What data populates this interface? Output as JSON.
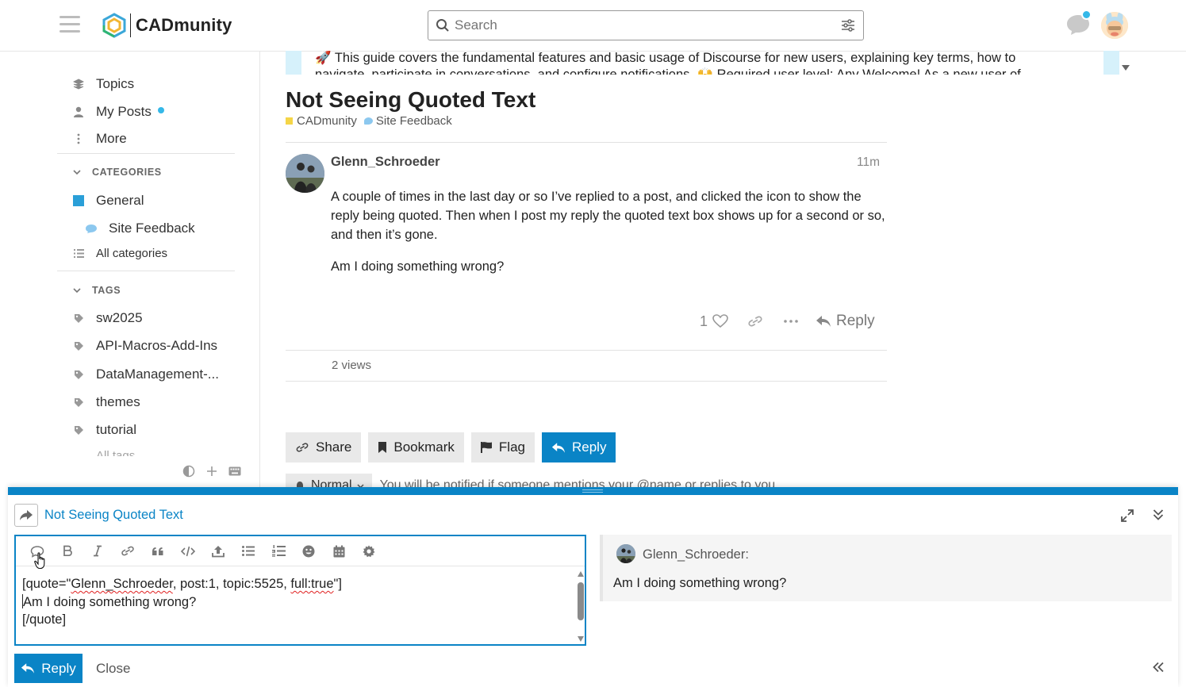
{
  "header": {
    "logo_text": "CADmunity",
    "search_placeholder": "Search"
  },
  "sidebar": {
    "nav": [
      {
        "label": "Topics",
        "icon": "layers-icon"
      },
      {
        "label": "My Posts",
        "icon": "user-icon"
      },
      {
        "label": "More",
        "icon": "vertical-ellipsis-icon"
      }
    ],
    "categories_heading": "CATEGORIES",
    "categories": [
      {
        "label": "General",
        "color": "#2a9fd8"
      },
      {
        "label": "Site Feedback",
        "color": "#8cc8ef"
      }
    ],
    "all_categories": "All categories",
    "tags_heading": "TAGS",
    "tags": [
      "sw2025",
      "API-Macros-Add-Ins",
      "DataManagement-...",
      "themes",
      "tutorial"
    ],
    "tags_partial": "All tags"
  },
  "banner": {
    "text": "🚀 This guide covers the fundamental features and basic usage of Discourse for new users, explaining key terms, how to navigate, participate in conversations, and configure notifications. 🙌 Required user level: Any Welcome! As a new user of"
  },
  "topic": {
    "title": "Not Seeing Quoted Text",
    "category_parent": "CADmunity",
    "category_parent_color": "#f5d547",
    "category": "Site Feedback",
    "category_color": "#8cc8ef"
  },
  "post": {
    "author": "Glenn_Schroeder",
    "time": "11m",
    "paragraphs": [
      "A couple of times in the last day or so I’ve replied to a post, and clicked the icon to show the reply being quoted. Then when I post my reply the quoted text box shows up for a second or so, and then it’s gone.",
      "Am I doing something wrong?"
    ],
    "like_count": "1",
    "reply_label": "Reply",
    "views": "2 views"
  },
  "footer_buttons": {
    "share": "Share",
    "bookmark": "Bookmark",
    "flag": "Flag",
    "reply": "Reply"
  },
  "notifications": {
    "level": "Normal",
    "text": "You will be notified if someone mentions your @name or replies to you."
  },
  "composer": {
    "reply_to_title": "Not Seeing Quoted Text",
    "editor_line1_a": "[quote=\"",
    "editor_line1_name": "Glenn_Schroeder",
    "editor_line1_b": ", post:1, topic:5525, ",
    "editor_line1_full": "full:true",
    "editor_line1_c": "\"]",
    "editor_line2": "Am I doing something wrong?",
    "editor_line3": "[/quote]",
    "preview_author": "Glenn_Schroeder:",
    "preview_body": "Am I doing something wrong?",
    "reply_button": "Reply",
    "close_button": "Close"
  },
  "colors": {
    "accent": "#0a84c6",
    "notification_dot": "#35b8e8"
  }
}
